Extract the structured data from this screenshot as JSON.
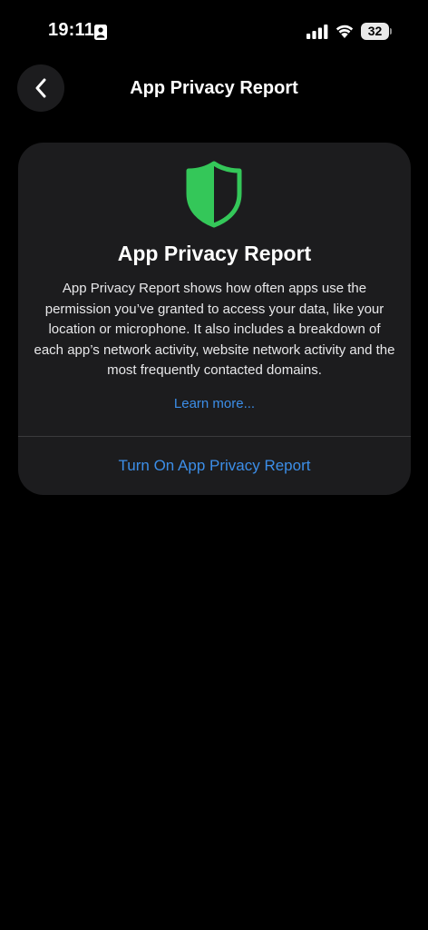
{
  "status_bar": {
    "time": "19:11",
    "battery_level": "32",
    "icons": [
      "focus-person-icon",
      "cellular-signal-icon",
      "wifi-icon",
      "battery-icon"
    ]
  },
  "nav": {
    "back_icon": "chevron-left-icon",
    "title": "App Privacy Report"
  },
  "card": {
    "icon": "shield-icon",
    "icon_color": "#34c759",
    "title": "App Privacy Report",
    "description": "App Privacy Report shows how often apps use the permission you’ve granted to access your data, like your location or microphone. It also includes a breakdown of each app’s network activity, website network activity and the most frequently contacted domains.",
    "learn_more": "Learn more...",
    "turn_on_button": "Turn On App Privacy Report"
  },
  "colors": {
    "background": "#000000",
    "card_background": "#1c1c1e",
    "accent": "#3c8ee8",
    "shield_green": "#34c759"
  }
}
